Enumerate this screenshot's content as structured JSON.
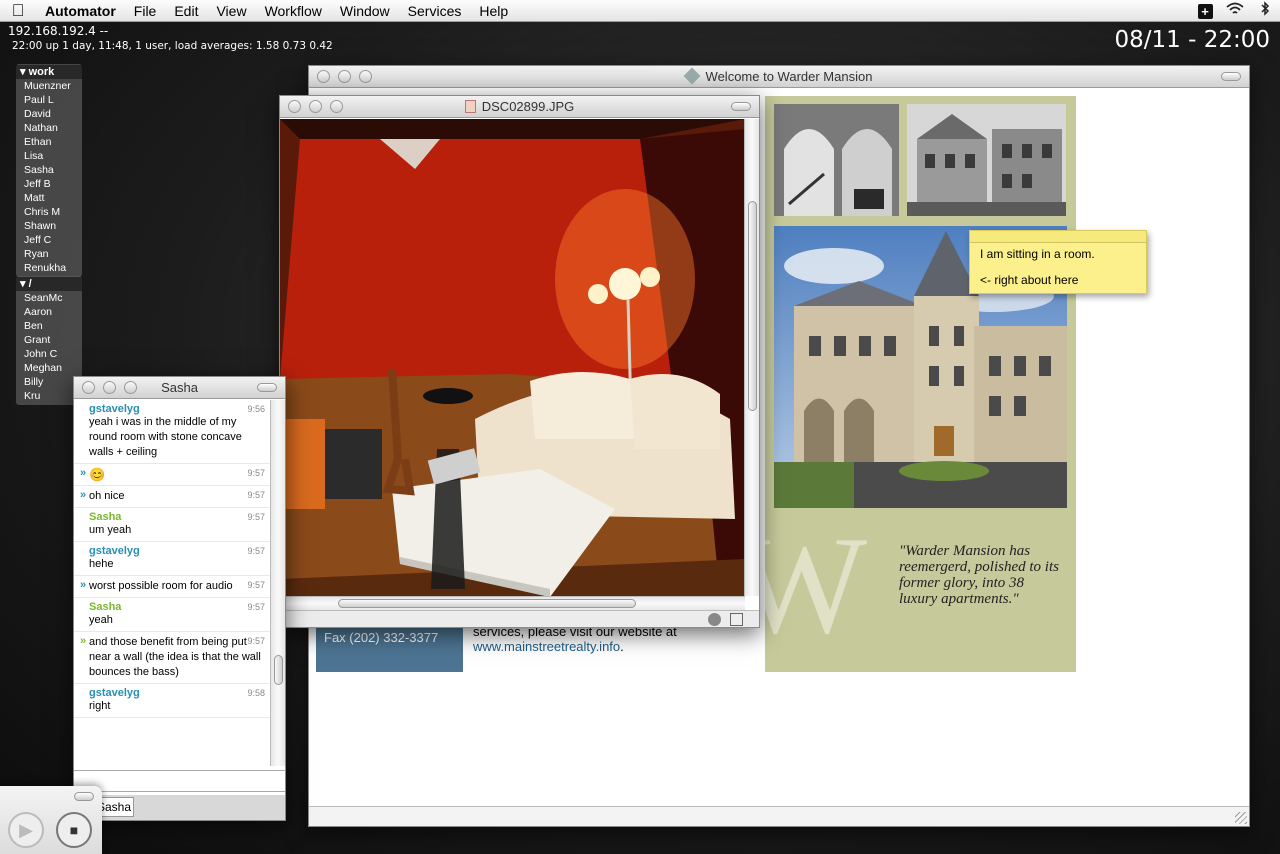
{
  "menubar": {
    "apple": "",
    "app": "Automator",
    "items": [
      "File",
      "Edit",
      "View",
      "Workflow",
      "Window",
      "Services",
      "Help"
    ]
  },
  "desktop": {
    "host": "192.168.192.4 --",
    "uptime": "22:00  up 1 day, 11:48, 1 user, load averages: 1.58 0.73 0.42",
    "clock": "08/11 - 22:00"
  },
  "buddylist": {
    "group1": {
      "label": "work",
      "members": [
        "Muenzner",
        "Paul L",
        "David",
        "Nathan",
        "Ethan",
        "Lisa",
        "Sasha",
        "Jeff B",
        "Matt",
        "Chris M",
        "Shawn",
        "Jeff C",
        "Ryan",
        "Renukha"
      ]
    },
    "group2": {
      "label": "/",
      "members": [
        "SeanMc",
        "Aaron",
        "Ben",
        "Grant",
        "John C",
        "Meghan",
        "Billy",
        "Kru"
      ]
    }
  },
  "browser": {
    "title": "Welcome to Warder Mansion",
    "fax": "Fax (202) 332-3377",
    "body_text": "services, please visit our website at",
    "link": "www.mainstreetrealty.info",
    "link_suffix": ".",
    "monogram": "W",
    "quote": "\"Warder Mansion has reemergerd, polished to its former glory, into 38 luxury apartments.\"",
    "sticky": {
      "line1": "I am sitting in a room.",
      "line2": "<- right about here"
    },
    "colors": {
      "sage": "#c6c99a",
      "slate": "#4d7593",
      "link": "#1f5f8b"
    }
  },
  "preview": {
    "title": "DSC02899.JPG"
  },
  "chat": {
    "title": "Sasha",
    "tab": "Sasha",
    "messages": [
      {
        "sender": "gstavelyg",
        "time": "9:56",
        "text": "yeah i was in the middle of my round room with stone concave walls + ceiling"
      },
      {
        "sender": "",
        "time": "9:57",
        "text": "😊"
      },
      {
        "sender": "",
        "time": "9:57",
        "text": "oh nice"
      },
      {
        "sender": "Sasha",
        "time": "9:57",
        "text": "um yeah"
      },
      {
        "sender": "gstavelyg",
        "time": "9:57",
        "text": "hehe"
      },
      {
        "sender": "",
        "time": "9:57",
        "text": "worst possible room for audio"
      },
      {
        "sender": "Sasha",
        "time": "9:57",
        "text": "yeah"
      },
      {
        "sender": "",
        "time": "9:57",
        "text": "and those benefit from being put near a wall (the idea is that the wall bounces the bass)"
      },
      {
        "sender": "gstavelyg",
        "time": "9:58",
        "text": "right"
      }
    ],
    "colors": {
      "me": "#2a8fb0",
      "them": "#7ab82c"
    }
  },
  "player": {
    "play": "▶",
    "stop": "■"
  }
}
